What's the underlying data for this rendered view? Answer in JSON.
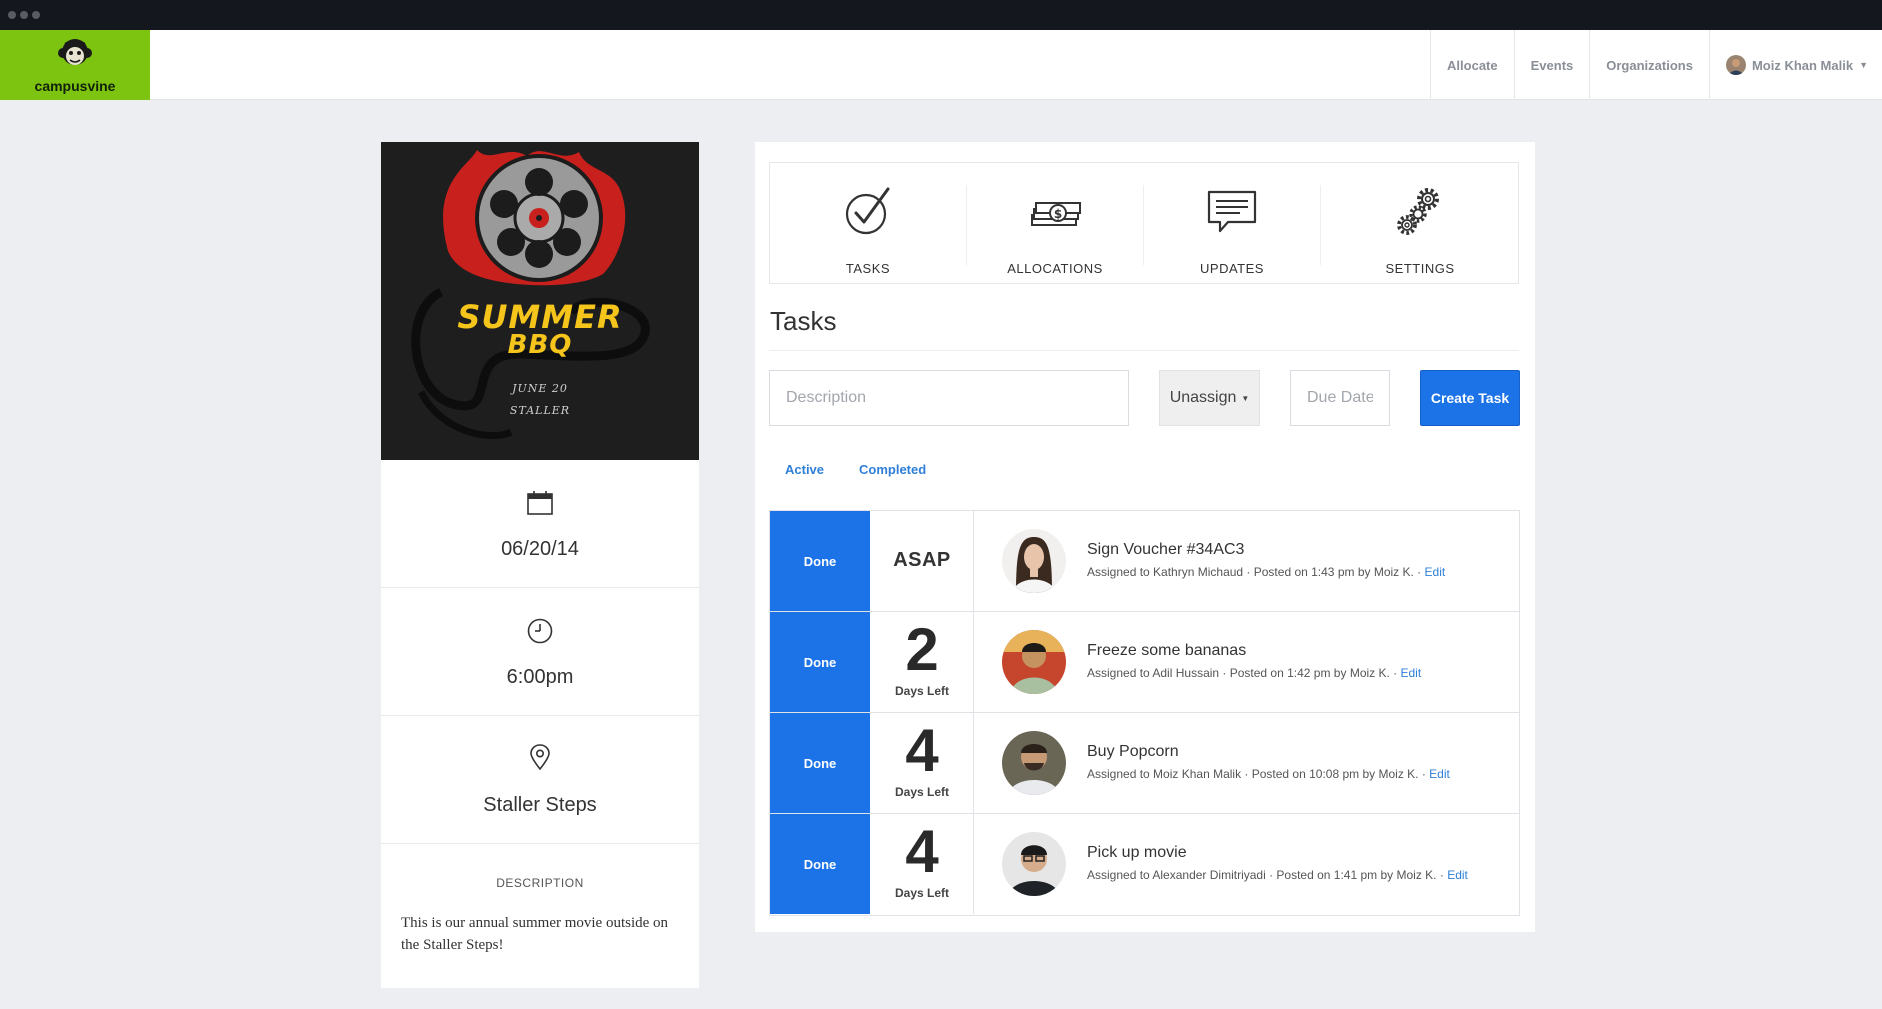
{
  "app": {
    "brand": "campusvine"
  },
  "nav": {
    "items": [
      {
        "label": "Allocate"
      },
      {
        "label": "Events"
      },
      {
        "label": "Organizations"
      }
    ],
    "user_name": "Moiz Khan Malik"
  },
  "event": {
    "poster": {
      "line1": "SUMMER",
      "line2": "BBQ",
      "date_line": "JUNE 20",
      "place_line": "STALLER"
    },
    "date": "06/20/14",
    "time": "6:00pm",
    "location": "Staller Steps",
    "description_label": "DESCRIPTION",
    "description": "This is our annual summer movie outside on the Staller Steps!"
  },
  "tabs": [
    {
      "label": "TASKS",
      "icon": "check-icon"
    },
    {
      "label": "ALLOCATIONS",
      "icon": "money-stack-icon"
    },
    {
      "label": "UPDATES",
      "icon": "speech-bubble-icon"
    },
    {
      "label": "SETTINGS",
      "icon": "gears-icon"
    }
  ],
  "tasks_section": {
    "title": "Tasks",
    "description_placeholder": "Description",
    "assign_label": "Unassign",
    "due_placeholder": "Due Date",
    "create_label": "Create Task",
    "filters": {
      "active": "Active",
      "completed": "Completed"
    }
  },
  "tasks": [
    {
      "done_label": "Done",
      "due_text": "ASAP",
      "title": "Sign Voucher #34AC3",
      "meta": "Assigned to Kathryn Michaud · Posted on 1:43 pm by Moiz K. ·",
      "edit_label": "Edit"
    },
    {
      "done_label": "Done",
      "due_number": "2",
      "due_sub": "Days Left",
      "title": "Freeze some bananas",
      "meta": "Assigned to Adil Hussain · Posted on 1:42 pm by Moiz K. ·",
      "edit_label": "Edit"
    },
    {
      "done_label": "Done",
      "due_number": "4",
      "due_sub": "Days Left",
      "title": "Buy Popcorn",
      "meta": "Assigned to Moiz Khan Malik · Posted on 10:08 pm by Moiz K. ·",
      "edit_label": "Edit"
    },
    {
      "done_label": "Done",
      "due_number": "4",
      "due_sub": "Days Left",
      "title": "Pick up movie",
      "meta": "Assigned to Alexander Dimitriyadi · Posted on 1:41 pm by Moiz K. ·",
      "edit_label": "Edit"
    }
  ],
  "colors": {
    "brand_green": "#7cc40f",
    "primary_blue": "#1c73e8",
    "link_blue": "#2e7fd8",
    "page_bg": "#eceef1"
  }
}
